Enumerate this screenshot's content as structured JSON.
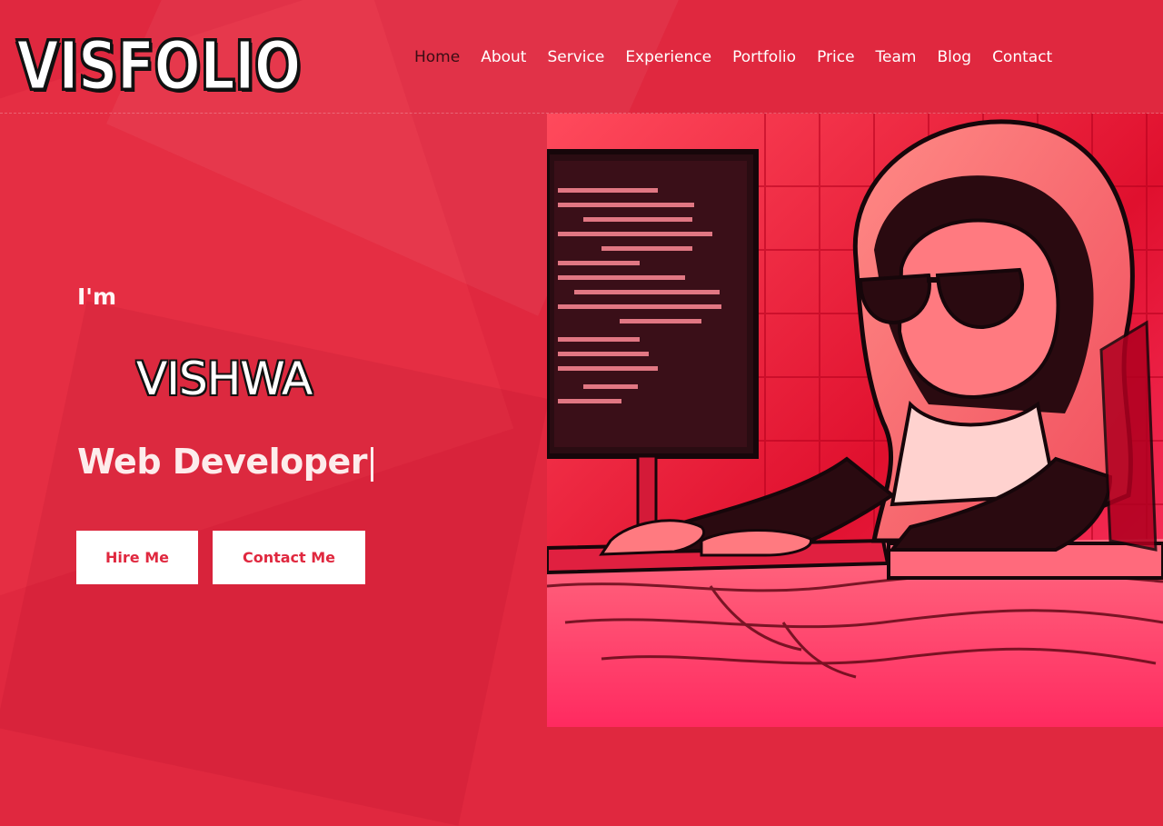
{
  "brand": {
    "logo": "VISFOLIO"
  },
  "nav": {
    "items": [
      {
        "label": "Home",
        "active": true
      },
      {
        "label": "About"
      },
      {
        "label": "Service"
      },
      {
        "label": "Experience"
      },
      {
        "label": "Portfolio"
      },
      {
        "label": "Price"
      },
      {
        "label": "Team"
      },
      {
        "label": "Blog"
      },
      {
        "label": "Contact"
      }
    ]
  },
  "hero": {
    "greeting": "I'm",
    "name": "VISHWA",
    "role": "Web Developer",
    "buttons": {
      "hire": "Hire Me",
      "contact": "Contact Me"
    },
    "image_subject": "hooded-hacker-at-computer"
  },
  "colors": {
    "accent": "#e0283f",
    "dark": "#3a0d14",
    "white": "#ffffff"
  }
}
